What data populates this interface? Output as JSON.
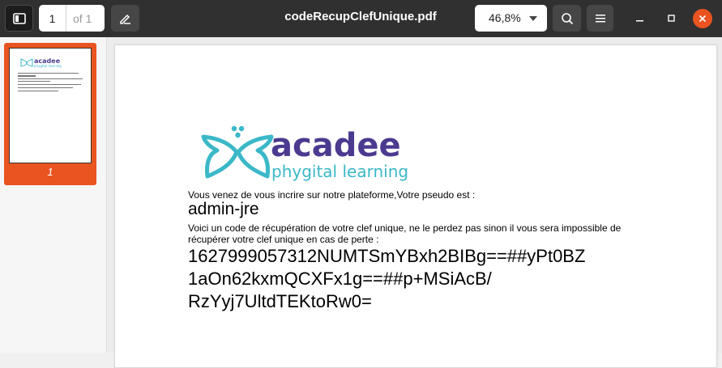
{
  "header": {
    "page_current": "1",
    "page_total": "of 1",
    "title": "codeRecupClefUnique.pdf",
    "zoom": "46,8%",
    "accent_color": "#e95420"
  },
  "icons": {
    "sidebar_toggle": "sidebar-icon",
    "annotate": "pencil-icon",
    "zoom_dropdown": "chevron-down-icon",
    "search": "search-icon",
    "menu": "hamburger-icon",
    "minimize": "minimize-icon",
    "maximize": "maximize-icon",
    "close": "close-icon"
  },
  "sidebar": {
    "thumbnails": [
      {
        "label": "1"
      }
    ]
  },
  "document": {
    "logo": {
      "brand": "acadee",
      "tagline": "phygital learning",
      "brand_color": "#4b3a8f",
      "tagline_color": "#3bb8c8"
    },
    "intro": "Vous venez de vous incrire sur notre plateforme,Votre pseudo est :",
    "pseudo": "admin-jre",
    "info_line1": "Voici un code de récupération de votre clef unique, ne le perdez pas sinon il vous sera impossible de",
    "info_line2": "récupérer votre clef unique en cas de perte :",
    "code_line1": "1627999057312NUMTSmYBxh2BIBg==##yPt0BZ",
    "code_line2": "1aOn62kxmQCXFx1g==##p+MSiAcB/",
    "code_line3": "RzYyj7UltdTEKtoRw0="
  }
}
